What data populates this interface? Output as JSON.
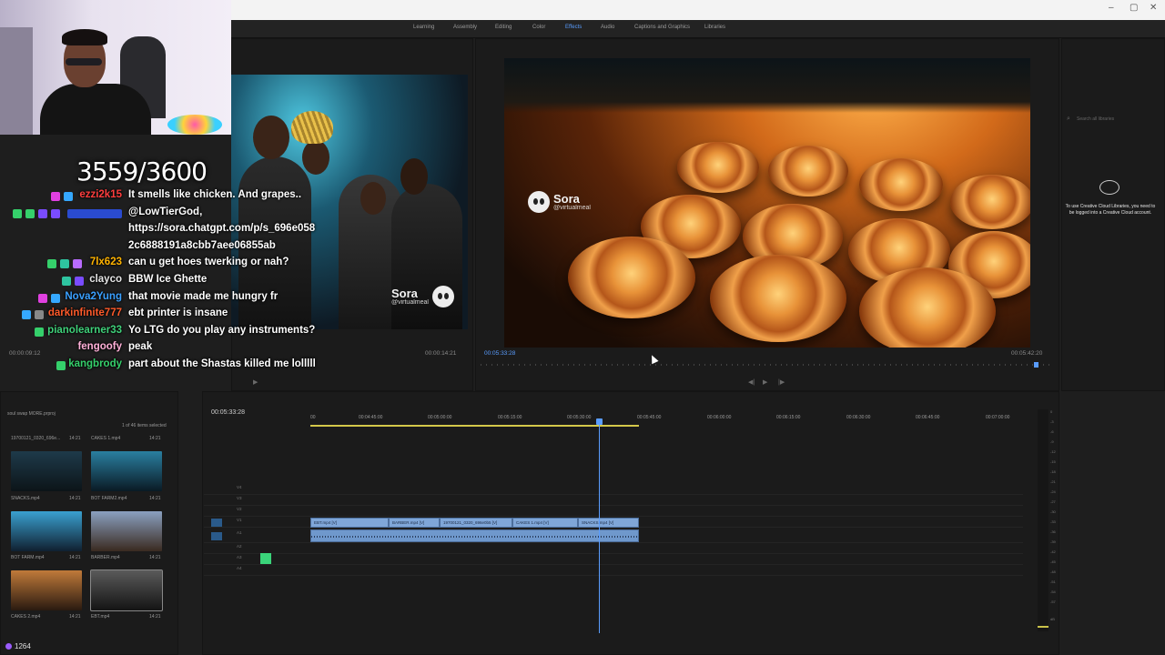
{
  "workspaces": [
    "Learning",
    "Assembly",
    "Editing",
    "Color",
    "Effects",
    "Audio",
    "Captions and Graphics",
    "Libraries"
  ],
  "active_workspace": "Effects",
  "follow_goal": "3559/3600",
  "chat": [
    {
      "user": "ezzi2k15",
      "color": "#ff3d3d",
      "text": "It smells like chicken. And grapes.."
    },
    {
      "user": "",
      "color": "#2a4bd0",
      "text": "@LowTierGod,"
    },
    {
      "user": "",
      "color": "#ffffff",
      "text": "https://sora.chatgpt.com/p/s_696e058"
    },
    {
      "user": "",
      "color": "#ffffff",
      "text": "2c6888191a8cbb7aee06855ab"
    },
    {
      "user": "7lx623",
      "color": "#ffb300",
      "text": "can u get hoes twerking or nah?"
    },
    {
      "user": "clayco",
      "color": "#e6e6e6",
      "text": "BBW Ice Ghette"
    },
    {
      "user": "Nova2Yung",
      "color": "#3aa0ff",
      "text": "that movie made me hungry fr"
    },
    {
      "user": "darkinfinite777",
      "color": "#ff5a2a",
      "text": "ebt printer is insane"
    },
    {
      "user": "pianolearner33",
      "color": "#3fd17a",
      "text": "Yo LTG do you play any instruments?"
    },
    {
      "user": "fengoofy",
      "color": "#ffb0d8",
      "text": "peak"
    },
    {
      "user": "kangbrody",
      "color": "#35d06b",
      "text": "part about the Shastas killed me lolllll"
    }
  ],
  "source_overlay": {
    "name": "Sora",
    "handle": "@virtualmeal"
  },
  "program_overlay": {
    "name": "Sora",
    "handle": "@virtualmeal"
  },
  "source_timecodes": {
    "left": "00:00:09:12",
    "right": "00:00:14:21"
  },
  "program_timecodes": {
    "left": "00:05:33:28",
    "right": "00:05:42:20"
  },
  "timeline_timecode": "00:05:33:28",
  "project": {
    "title": "soul swap MORE.prproj",
    "items_selected": "1 of 46 items selected",
    "bins": [
      {
        "name": "19700121_0320_696e...",
        "dur": "14:21"
      },
      {
        "name": "CAKES 1.mp4",
        "dur": "14:21"
      },
      {
        "name": "SNACKS.mp4",
        "dur": "14:21"
      },
      {
        "name": "BOT FARM2.mp4",
        "dur": "14:21"
      },
      {
        "name": "BOT FARM.mp4",
        "dur": "14:21"
      },
      {
        "name": "BARBER.mp4",
        "dur": "14:21"
      },
      {
        "name": "CAKES 2.mp4",
        "dur": "14:21"
      },
      {
        "name": "EBT.mp4",
        "dur": "14:21"
      }
    ]
  },
  "ruler_ticks": [
    "00",
    "00:04:45:00",
    "00:05:00:00",
    "00:05:15:00",
    "00:05:30:00",
    "00:05:45:00",
    "00:06:00:00",
    "00:06:15:00",
    "00:06:30:00",
    "00:06:45:00",
    "00:07:00:00"
  ],
  "tracks": [
    "V4",
    "V3",
    "V2",
    "V1",
    "A1",
    "A2",
    "A3",
    "A4"
  ],
  "clips": [
    "EBT.mp4 [V]",
    "BARBER.mp4 [V]",
    "19700121_0320_696e0b5 [V]",
    "CAKES 1.mp4 [V]",
    "SNACKS.mp4 [V]"
  ],
  "libraries_message": "To use Creative Cloud Libraries, you need to be logged into a Creative Cloud account.",
  "libraries_search": "Search all libraries",
  "meter_marks": [
    "0",
    "-3",
    "-6",
    "-9",
    "-12",
    "-15",
    "-18",
    "-21",
    "-24",
    "-27",
    "-30",
    "-33",
    "-36",
    "-39",
    "-42",
    "-45",
    "-48",
    "-51",
    "-54",
    "-57",
    "dB"
  ],
  "viewers": "1264",
  "colors": {
    "accent": "#5a9dff",
    "workarea": "#d4c84a",
    "clip": "#7fa6d8"
  }
}
